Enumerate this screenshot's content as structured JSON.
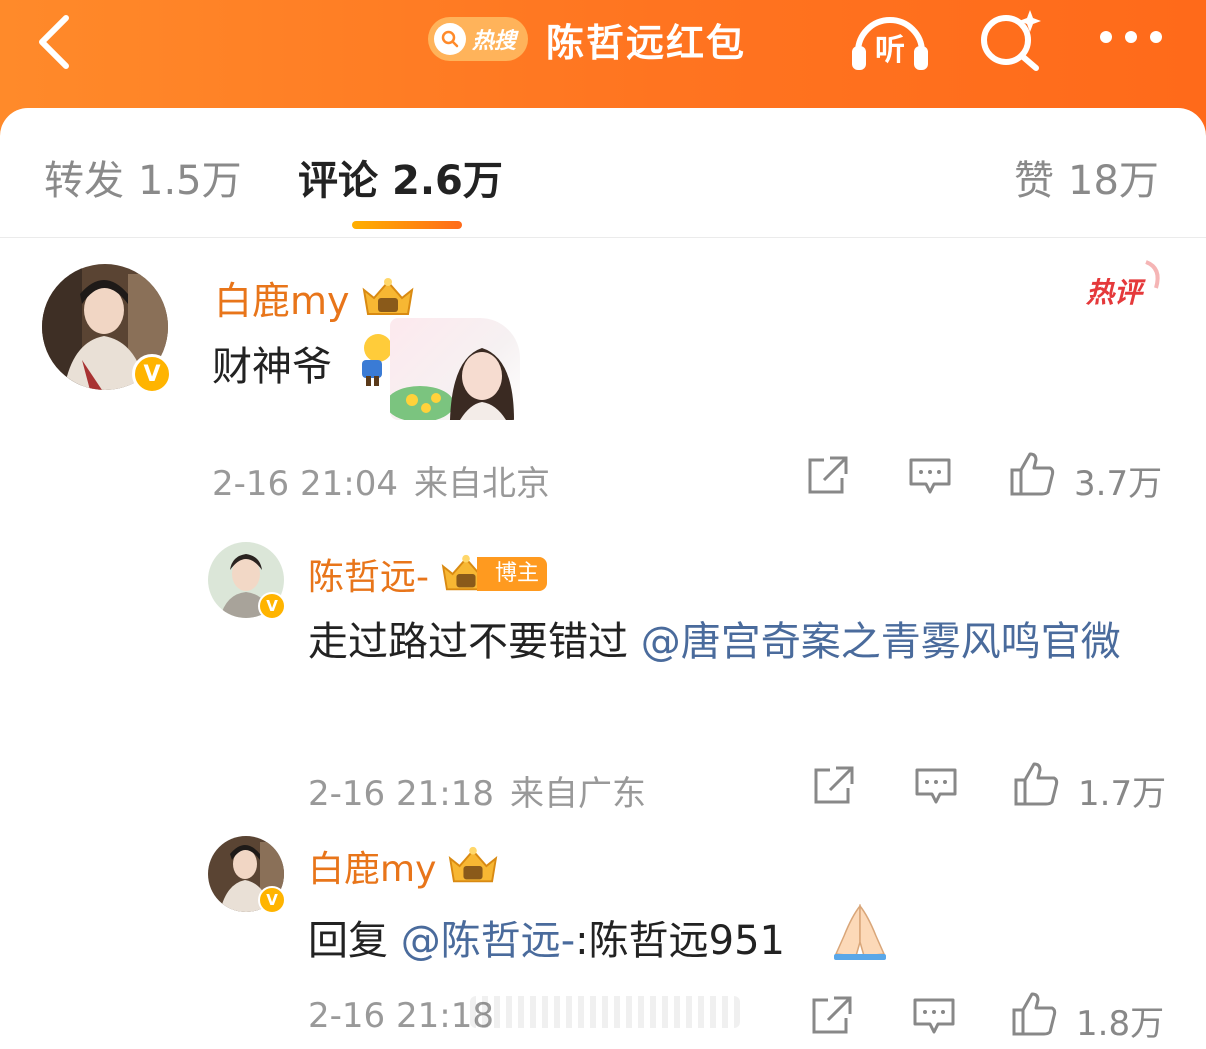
{
  "header": {
    "hot_search_label": "热搜",
    "title": "陈哲远红包",
    "listen_label": "听"
  },
  "tabs": [
    {
      "label": "转发",
      "count": "1.5万"
    },
    {
      "label": "评论",
      "count": "2.6万"
    },
    {
      "label": "赞",
      "count": "18万"
    }
  ],
  "comments": [
    {
      "username": "白鹿my",
      "hot_tag": "热评",
      "text": "财神爷",
      "time": "2-16 21:04",
      "location": "来自北京",
      "likes": "3.7万"
    },
    {
      "username": "陈哲远-",
      "badge": "博主",
      "text_prefix": "走过路过不要错过 ",
      "mention": "@唐宫奇案之青雾风鸣官微",
      "time": "2-16 21:18",
      "location": "来自广东",
      "likes": "1.7万"
    },
    {
      "username": "白鹿my",
      "text_prefix": "回复 ",
      "mention": "@陈哲远-",
      "text_suffix": ":陈哲远951",
      "time": "2-16 21:18",
      "likes": "1.8万"
    }
  ],
  "colors": {
    "header_orange": "#ff7a1f",
    "username_orange": "#e8751a",
    "mention_blue": "#4a6b9c",
    "hot_red": "#e5393b"
  }
}
